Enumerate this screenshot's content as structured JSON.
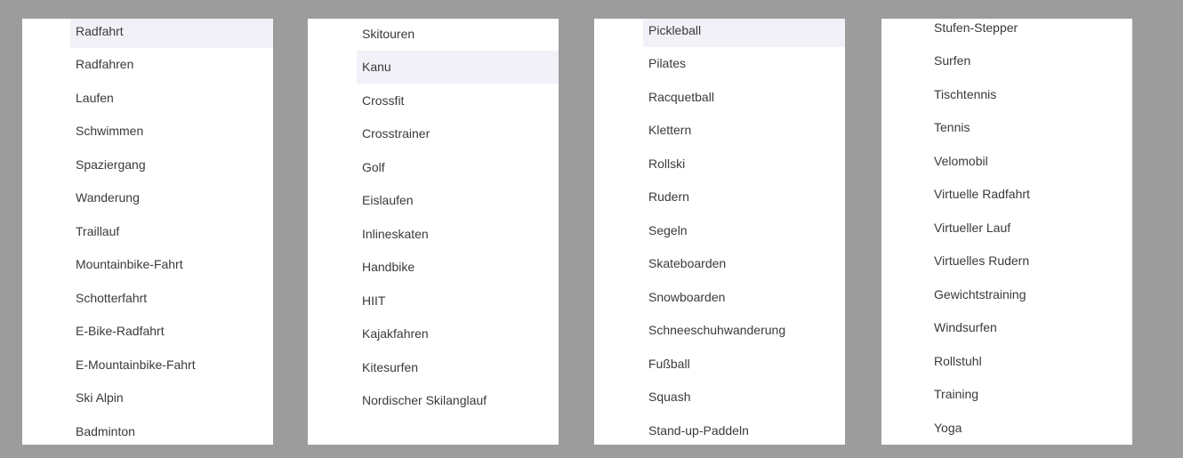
{
  "colors": {
    "background": "#9c9c9c",
    "panel": "#ffffff",
    "text": "#3a3a3a",
    "highlight": "#f2f1f7"
  },
  "lists": [
    {
      "highlighted_index": 0,
      "items": [
        "Radfahrt",
        "Radfahren",
        "Laufen",
        "Schwimmen",
        "Spaziergang",
        "Wanderung",
        "Traillauf",
        "Mountainbike-Fahrt",
        "Schotterfahrt",
        "E-Bike-Radfahrt",
        "E-Mountainbike-Fahrt",
        "Ski Alpin",
        "Badminton"
      ]
    },
    {
      "highlighted_index": 1,
      "items": [
        "Skitouren",
        "Kanu",
        "Crossfit",
        "Crosstrainer",
        "Golf",
        "Eislaufen",
        "Inlineskaten",
        "Handbike",
        "HIIT",
        "Kajakfahren",
        "Kitesurfen",
        "Nordischer Skilanglauf"
      ]
    },
    {
      "highlighted_index": 0,
      "items": [
        "Pickleball",
        "Pilates",
        "Racquetball",
        "Klettern",
        "Rollski",
        "Rudern",
        "Segeln",
        "Skateboarden",
        "Snowboarden",
        "Schneeschuhwanderung",
        "Fußball",
        "Squash",
        "Stand-up-Paddeln"
      ]
    },
    {
      "highlighted_index": -1,
      "items": [
        "Stufen-Stepper",
        "Surfen",
        "Tischtennis",
        "Tennis",
        "Velomobil",
        "Virtuelle Radfahrt",
        "Virtueller Lauf",
        "Virtuelles Rudern",
        "Gewichtstraining",
        "Windsurfen",
        "Rollstuhl",
        "Training",
        "Yoga"
      ]
    }
  ]
}
